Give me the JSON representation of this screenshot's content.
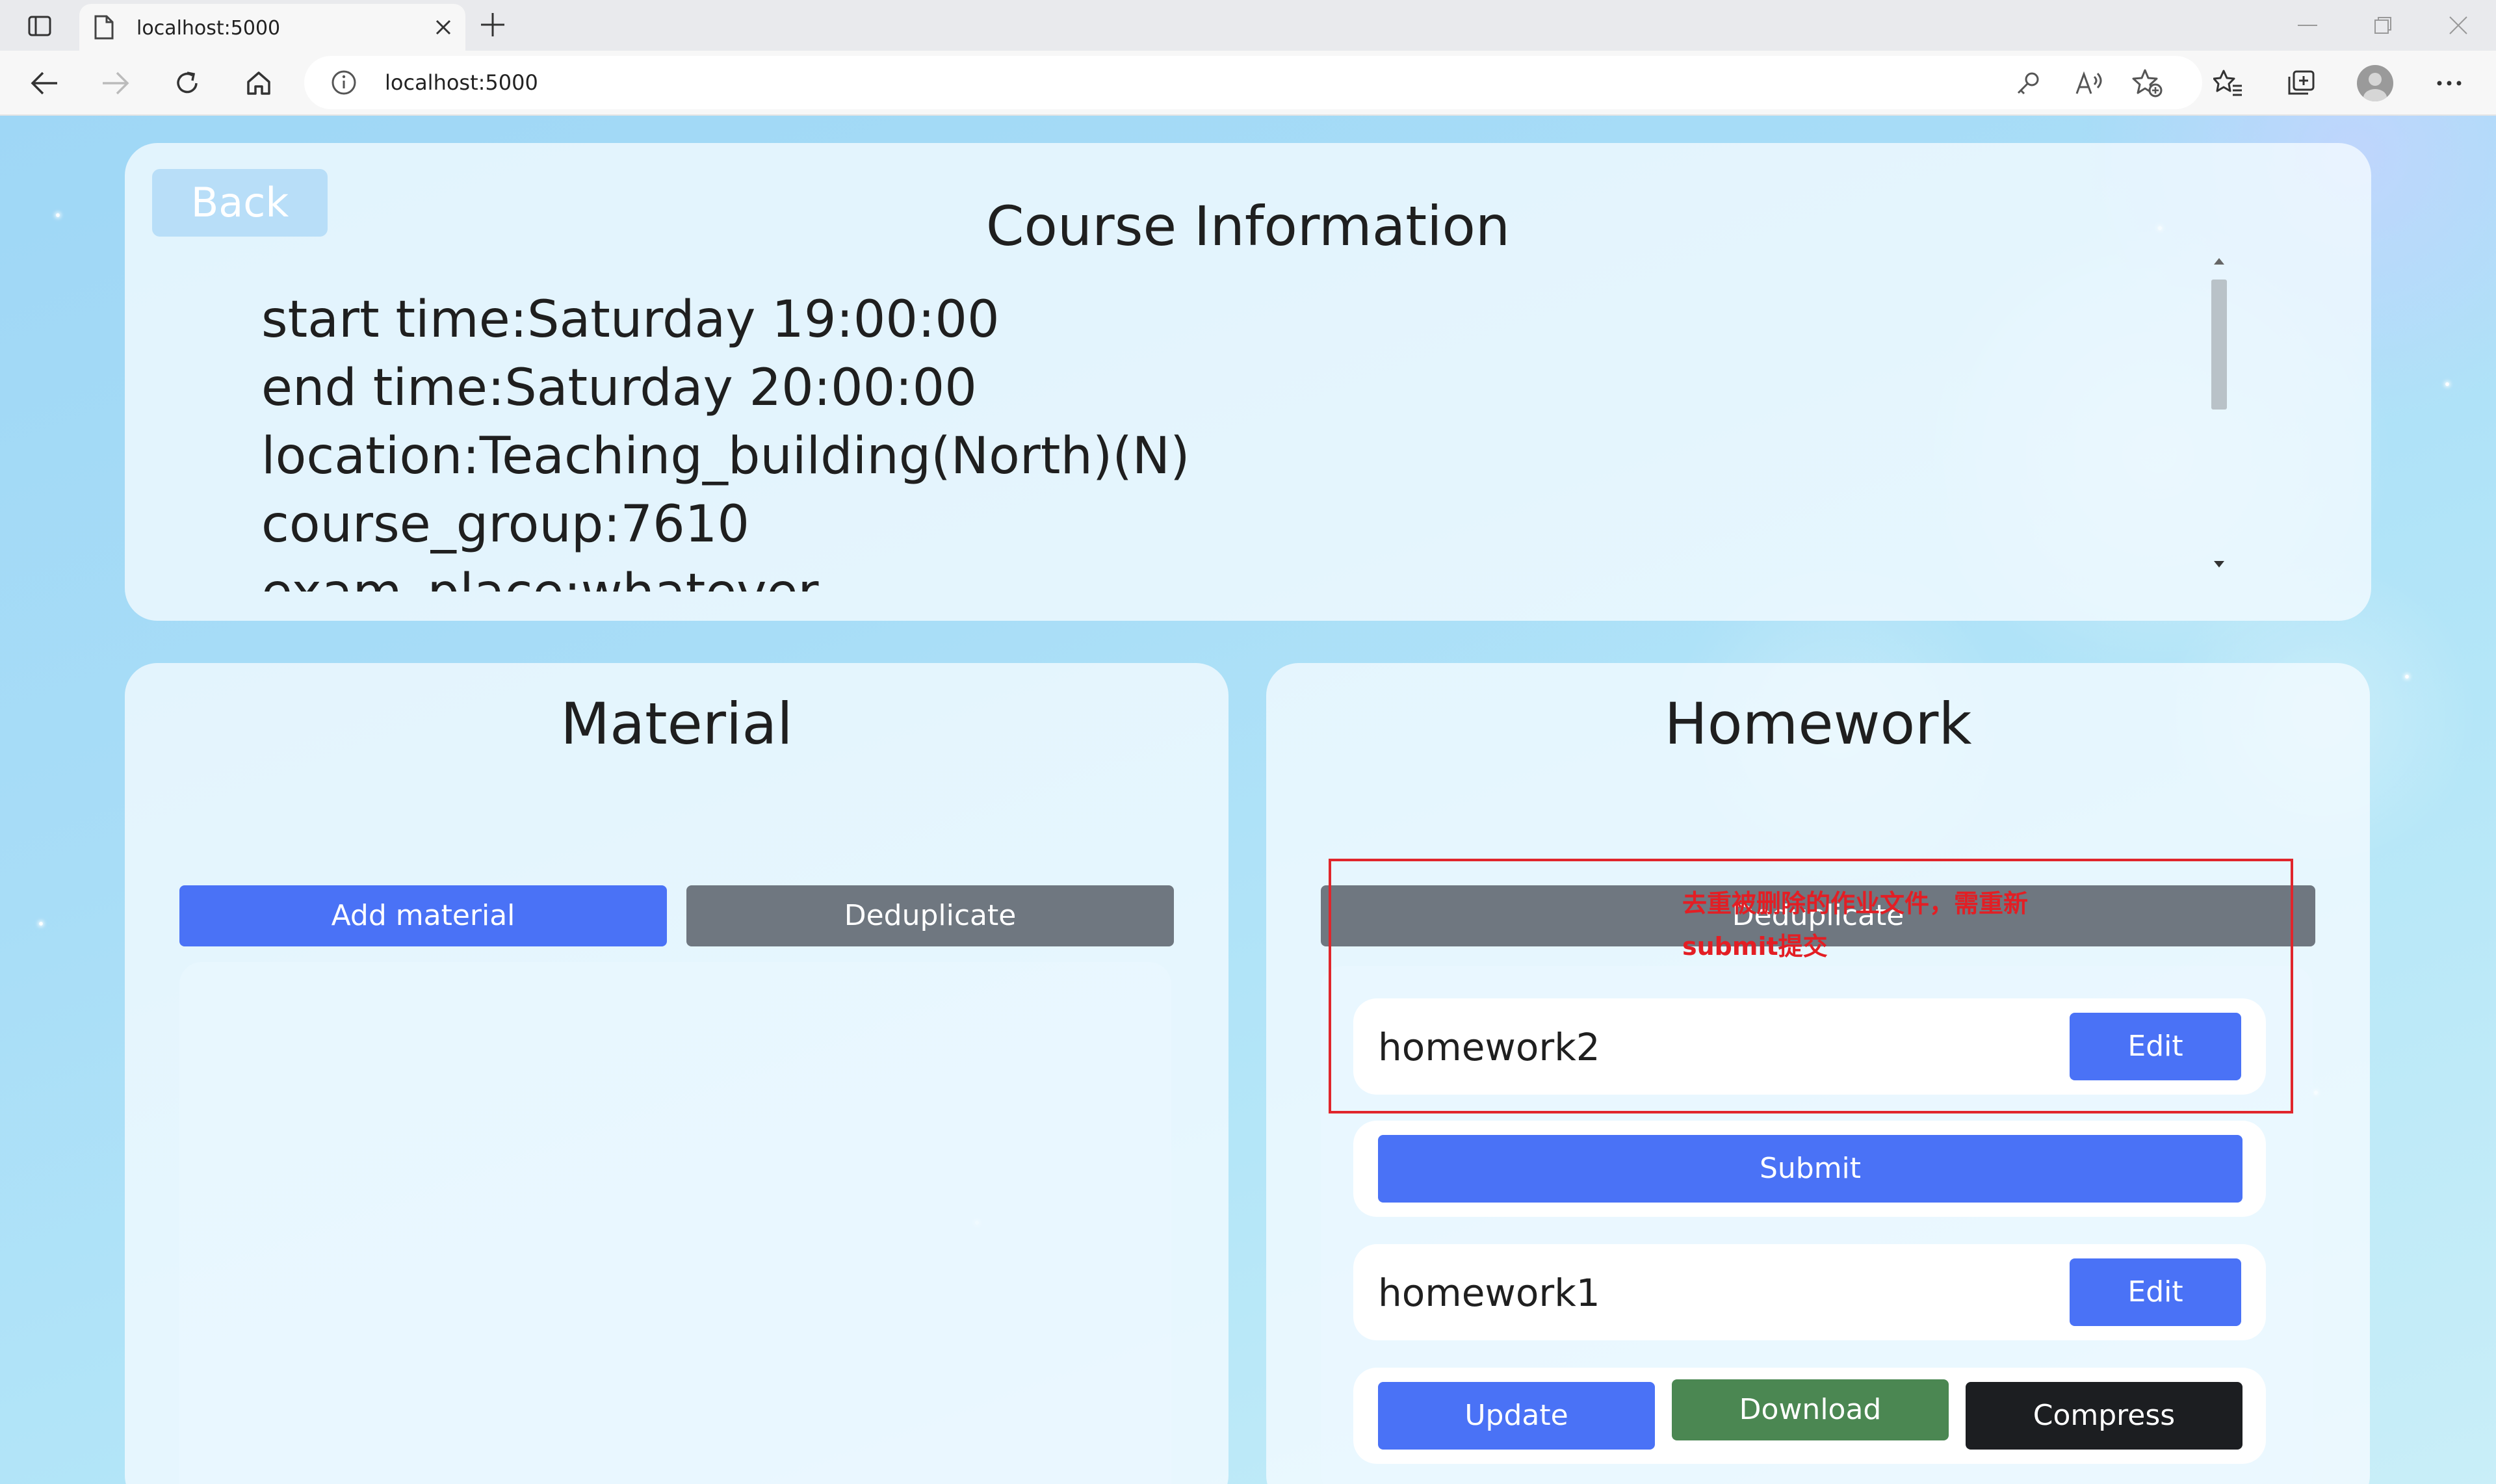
{
  "browser": {
    "tab_title": "localhost:5000",
    "url": "localhost:5000",
    "icons": {
      "tab_actions": "tab-actions-icon",
      "favicon": "page-icon",
      "tab_close": "close-icon",
      "new_tab": "plus-icon",
      "back": "arrow-left-icon",
      "forward": "arrow-right-icon",
      "refresh": "refresh-icon",
      "home": "home-icon",
      "site_info": "info-icon",
      "passwords": "key-icon",
      "read_aloud": "read-aloud-icon",
      "add_favorite": "star-add-icon",
      "favorites": "favorites-icon",
      "collections": "collections-icon",
      "profile": "avatar",
      "more": "more-icon"
    }
  },
  "course": {
    "back_label": "Back",
    "title": "Course Information",
    "lines": [
      "start time:Saturday 19:00:00",
      "end time:Saturday 20:00:00",
      "location:Teaching_building(North)(N)",
      "course_group:7610",
      "exam_place:whatever"
    ]
  },
  "material": {
    "title": "Material",
    "add_label": "Add material",
    "dedup_label": "Deduplicate"
  },
  "homework": {
    "title": "Homework",
    "dedup_label": "Deduplicate",
    "items": [
      {
        "name": "homework2",
        "edit_label": "Edit",
        "action_label": "Submit"
      },
      {
        "name": "homework1",
        "edit_label": "Edit",
        "update_label": "Update",
        "download_label": "Download",
        "compress_label": "Compress"
      }
    ]
  },
  "annotation": {
    "line1": "去重被删除的作业文件，需重新",
    "line2": "submit提交"
  },
  "colors": {
    "primary": "#4a72f6",
    "secondary": "#6f7780",
    "success": "#4b8752",
    "dark": "#1c1e21",
    "annotation_red": "#e31e24"
  }
}
